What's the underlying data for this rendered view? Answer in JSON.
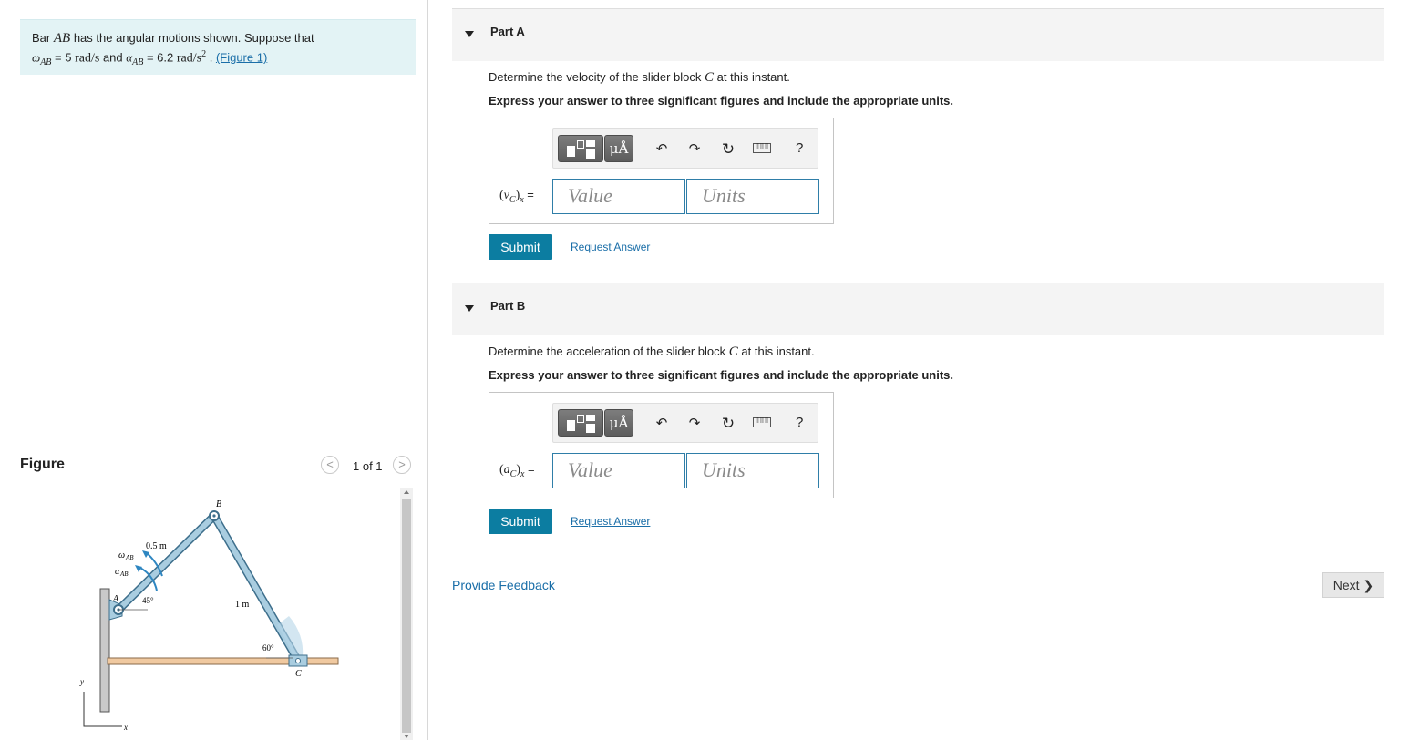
{
  "problem": {
    "text_1": "Bar",
    "bar_name": "AB",
    "text_2": "has the angular motions shown. Suppose that",
    "omega_symbol": "ω",
    "sub_ab": "AB",
    "omega_eq": "= 5",
    "omega_unit": "rad/s",
    "and": "and",
    "alpha_symbol": "α",
    "alpha_eq": "= 6.2",
    "alpha_unit": "rad/s",
    "alpha_unit_exp": "2",
    "sep": ".",
    "figure_link": "(Figure 1)"
  },
  "figure": {
    "title": "Figure",
    "pager": "1 of 1",
    "prev_glyph": "<",
    "next_glyph": ">",
    "labels": {
      "B": "B",
      "A": "A",
      "C": "C",
      "len_ab": "0.5 m",
      "len_bc": "1 m",
      "omega": "ω",
      "alpha": "α",
      "sub": "AB",
      "angle_a": "45°",
      "angle_c": "60°",
      "y_axis": "y",
      "x_axis": "x"
    },
    "colors": {
      "bar": "#a9cde0",
      "bar_edge": "#3e6f8c",
      "floor": "#f0c9a0"
    }
  },
  "parts": [
    {
      "title": "Part A",
      "question_pre": "Determine the velocity of the slider block",
      "question_var": "C",
      "question_post": "at this instant.",
      "instruction": "Express your answer to three significant figures and include the appropriate units.",
      "var_sym": "v",
      "var_sub": "C",
      "var_comp": "x",
      "var_eq": "=",
      "value_placeholder": "Value",
      "units_placeholder": "Units",
      "submit": "Submit",
      "request": "Request Answer"
    },
    {
      "title": "Part B",
      "question_pre": "Determine the acceleration of the slider block",
      "question_var": "C",
      "question_post": "at this instant.",
      "instruction": "Express your answer to three significant figures and include the appropriate units.",
      "var_sym": "a",
      "var_sub": "C",
      "var_comp": "x",
      "var_eq": "=",
      "value_placeholder": "Value",
      "units_placeholder": "Units",
      "submit": "Submit",
      "request": "Request Answer"
    }
  ],
  "toolbar": {
    "mu_label": "μÅ",
    "undo_icon": "undo-icon",
    "redo_icon": "redo-icon",
    "reset_icon": "reset-icon",
    "keyboard_icon": "keyboard-icon",
    "help": "?"
  },
  "footer": {
    "feedback": "Provide Feedback",
    "next": "Next"
  }
}
